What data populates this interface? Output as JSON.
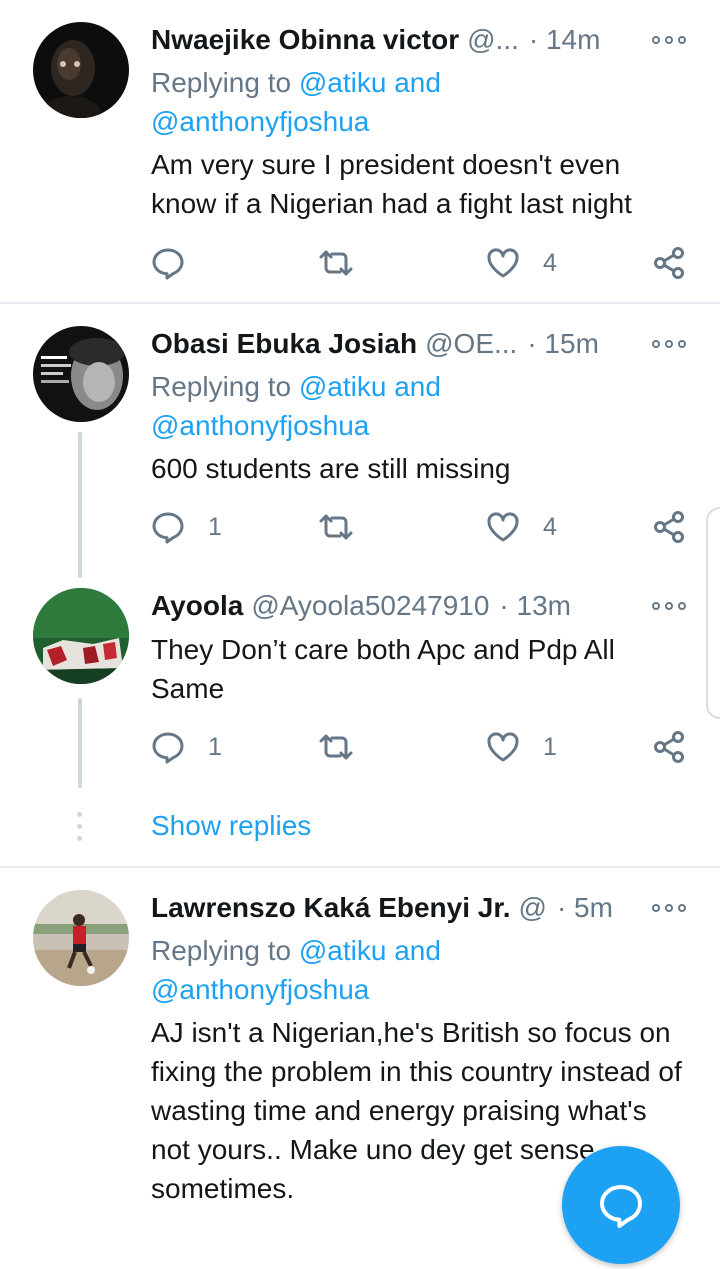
{
  "tweets": [
    {
      "name": "Nwaejike Obinna victor",
      "handle": "@...",
      "time": "· 14m",
      "replying_label": "Replying to",
      "mention1": "@atiku",
      "and": "and",
      "mention2": "@anthonyfjoshua",
      "text": "Am very sure I president doesn't even know if a Nigerian had a fight last night",
      "reply_count": "",
      "retweet_count": "",
      "like_count": "4"
    },
    {
      "name": "Obasi Ebuka Josiah",
      "handle": "@OE...",
      "time": "· 15m",
      "replying_label": "Replying to",
      "mention1": "@atiku",
      "and": "and",
      "mention2": "@anthonyfjoshua",
      "text": "600 students are still missing",
      "reply_count": "1",
      "retweet_count": "",
      "like_count": "4"
    },
    {
      "name": "Ayoola",
      "handle": "@Ayoola50247910",
      "time": "· 13m",
      "text": "They Don’t care both Apc and Pdp All Same",
      "reply_count": "1",
      "retweet_count": "",
      "like_count": "1"
    },
    {
      "name": "Lawrenszo Kaká Ebenyi Jr.",
      "handle": "@",
      "time": "· 5m",
      "replying_label": "Replying to",
      "mention1": "@atiku",
      "and": "and",
      "mention2": "@anthonyfjoshua",
      "text": "AJ isn't a Nigerian,he's British so focus on fixing the problem in this country instead of wasting time and energy praising what's not yours.. Make uno dey get sense sometimes."
    }
  ],
  "show_replies": "Show replies",
  "colors": {
    "accent": "#1da1f2",
    "secondary_text": "#657786",
    "divider": "#e6ecf0"
  },
  "icons": [
    "reply-icon",
    "retweet-icon",
    "like-icon",
    "share-icon",
    "more-icon",
    "compose-reply-icon"
  ]
}
